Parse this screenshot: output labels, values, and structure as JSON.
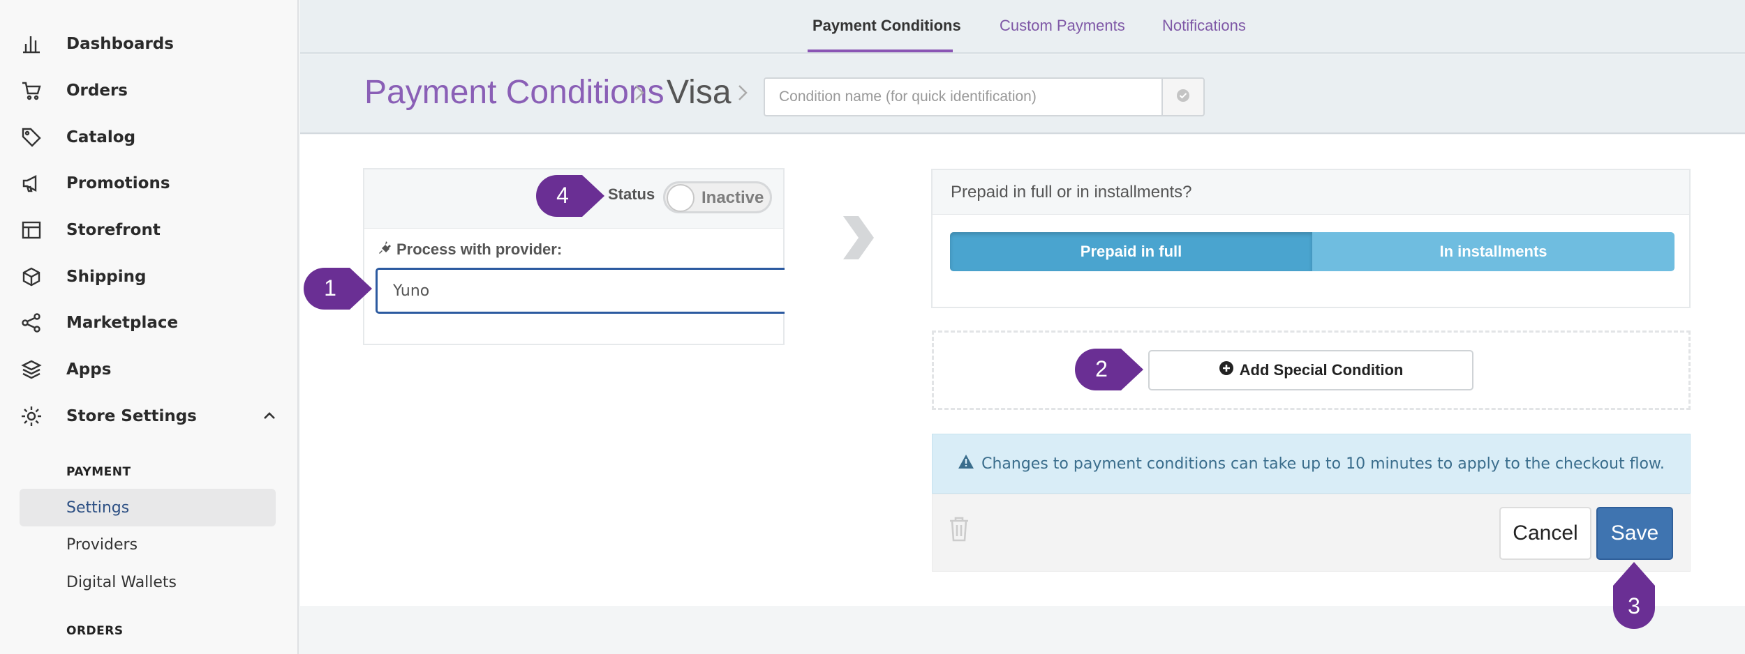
{
  "sidebar": {
    "items": [
      {
        "label": "Dashboards",
        "icon": "bar-chart-icon"
      },
      {
        "label": "Orders",
        "icon": "cart-icon"
      },
      {
        "label": "Catalog",
        "icon": "tag-icon"
      },
      {
        "label": "Promotions",
        "icon": "megaphone-icon"
      },
      {
        "label": "Storefront",
        "icon": "layout-icon"
      },
      {
        "label": "Shipping",
        "icon": "box-icon"
      },
      {
        "label": "Marketplace",
        "icon": "share-icon"
      },
      {
        "label": "Apps",
        "icon": "layers-icon"
      },
      {
        "label": "Store Settings",
        "icon": "gear-icon"
      }
    ],
    "section_payment": "PAYMENT",
    "sub_items": [
      "Settings",
      "Providers",
      "Digital Wallets"
    ],
    "section_orders": "ORDERS"
  },
  "tabs": [
    "Payment Conditions",
    "Custom Payments",
    "Notifications"
  ],
  "breadcrumb": {
    "root": "Payment Conditions",
    "current": "Visa"
  },
  "condition_name": {
    "placeholder": "Condition name (for quick identification)",
    "value": ""
  },
  "status": {
    "label": "Status",
    "state": "Inactive"
  },
  "provider": {
    "label": "Process with provider:",
    "value": "Yuno"
  },
  "payment_mode": {
    "question": "Prepaid in full or in installments?",
    "options": [
      "Prepaid in full",
      "In installments"
    ]
  },
  "special_condition_button": "Add Special Condition",
  "alert_text": "Changes to payment conditions can take up to 10 minutes to apply to the checkout flow.",
  "actions": {
    "cancel": "Cancel",
    "save": "Save"
  },
  "markers": [
    "1",
    "2",
    "3",
    "4"
  ],
  "colors": {
    "accent": "#7e57a6",
    "primary": "#3f74b0",
    "marker": "#6a2f94"
  }
}
